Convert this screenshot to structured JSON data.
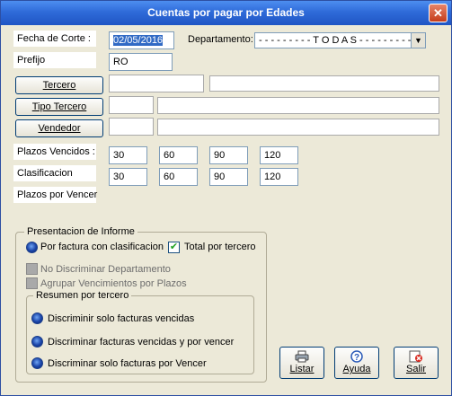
{
  "window": {
    "title": "Cuentas por pagar por Edades",
    "close_symbol": "✕"
  },
  "form": {
    "fecha_label": "Fecha de Corte :",
    "fecha_value": "02/05/2016",
    "departamento_label": "Departamento:",
    "departamento_value": "- - - - - - - - - T O D A S - - - - - - - - - -",
    "prefijo_label": "Prefijo",
    "prefijo_value": "RO",
    "tercero_button": "Tercero",
    "tipo_tercero_button": "Tipo Tercero",
    "vendedor_button": "Vendedor",
    "plazos_vencidos_label": "Plazos Vencidos :",
    "plazos_vencidos": [
      "30",
      "60",
      "90",
      "120"
    ],
    "clasificacion_label": "Clasificacion",
    "clasificacion": [
      "30",
      "60",
      "90",
      "120"
    ],
    "plazos_por_vencer_label": "Plazos por Vencer"
  },
  "presentacion": {
    "legend": "Presentacion de Informe",
    "por_factura": "Por factura con clasificacion",
    "total_por_tercero": "Total por tercero",
    "no_discriminar": "No Discriminar Departamento",
    "agrupar": "Agrupar Vencimientos por Plazos",
    "resumen_legend": "Resumen por tercero",
    "options": [
      "Discriminir solo facturas vencidas",
      "Discriminar facturas vencidas y por vencer",
      "Discriminar solo facturas por Vencer"
    ]
  },
  "actions": {
    "listar": "Listar",
    "ayuda": "Ayuda",
    "salir": "Salir"
  },
  "colors": {
    "title_bar": "#2f6bd9",
    "window_bg": "#ece9d8",
    "selection": "#316ac5"
  }
}
